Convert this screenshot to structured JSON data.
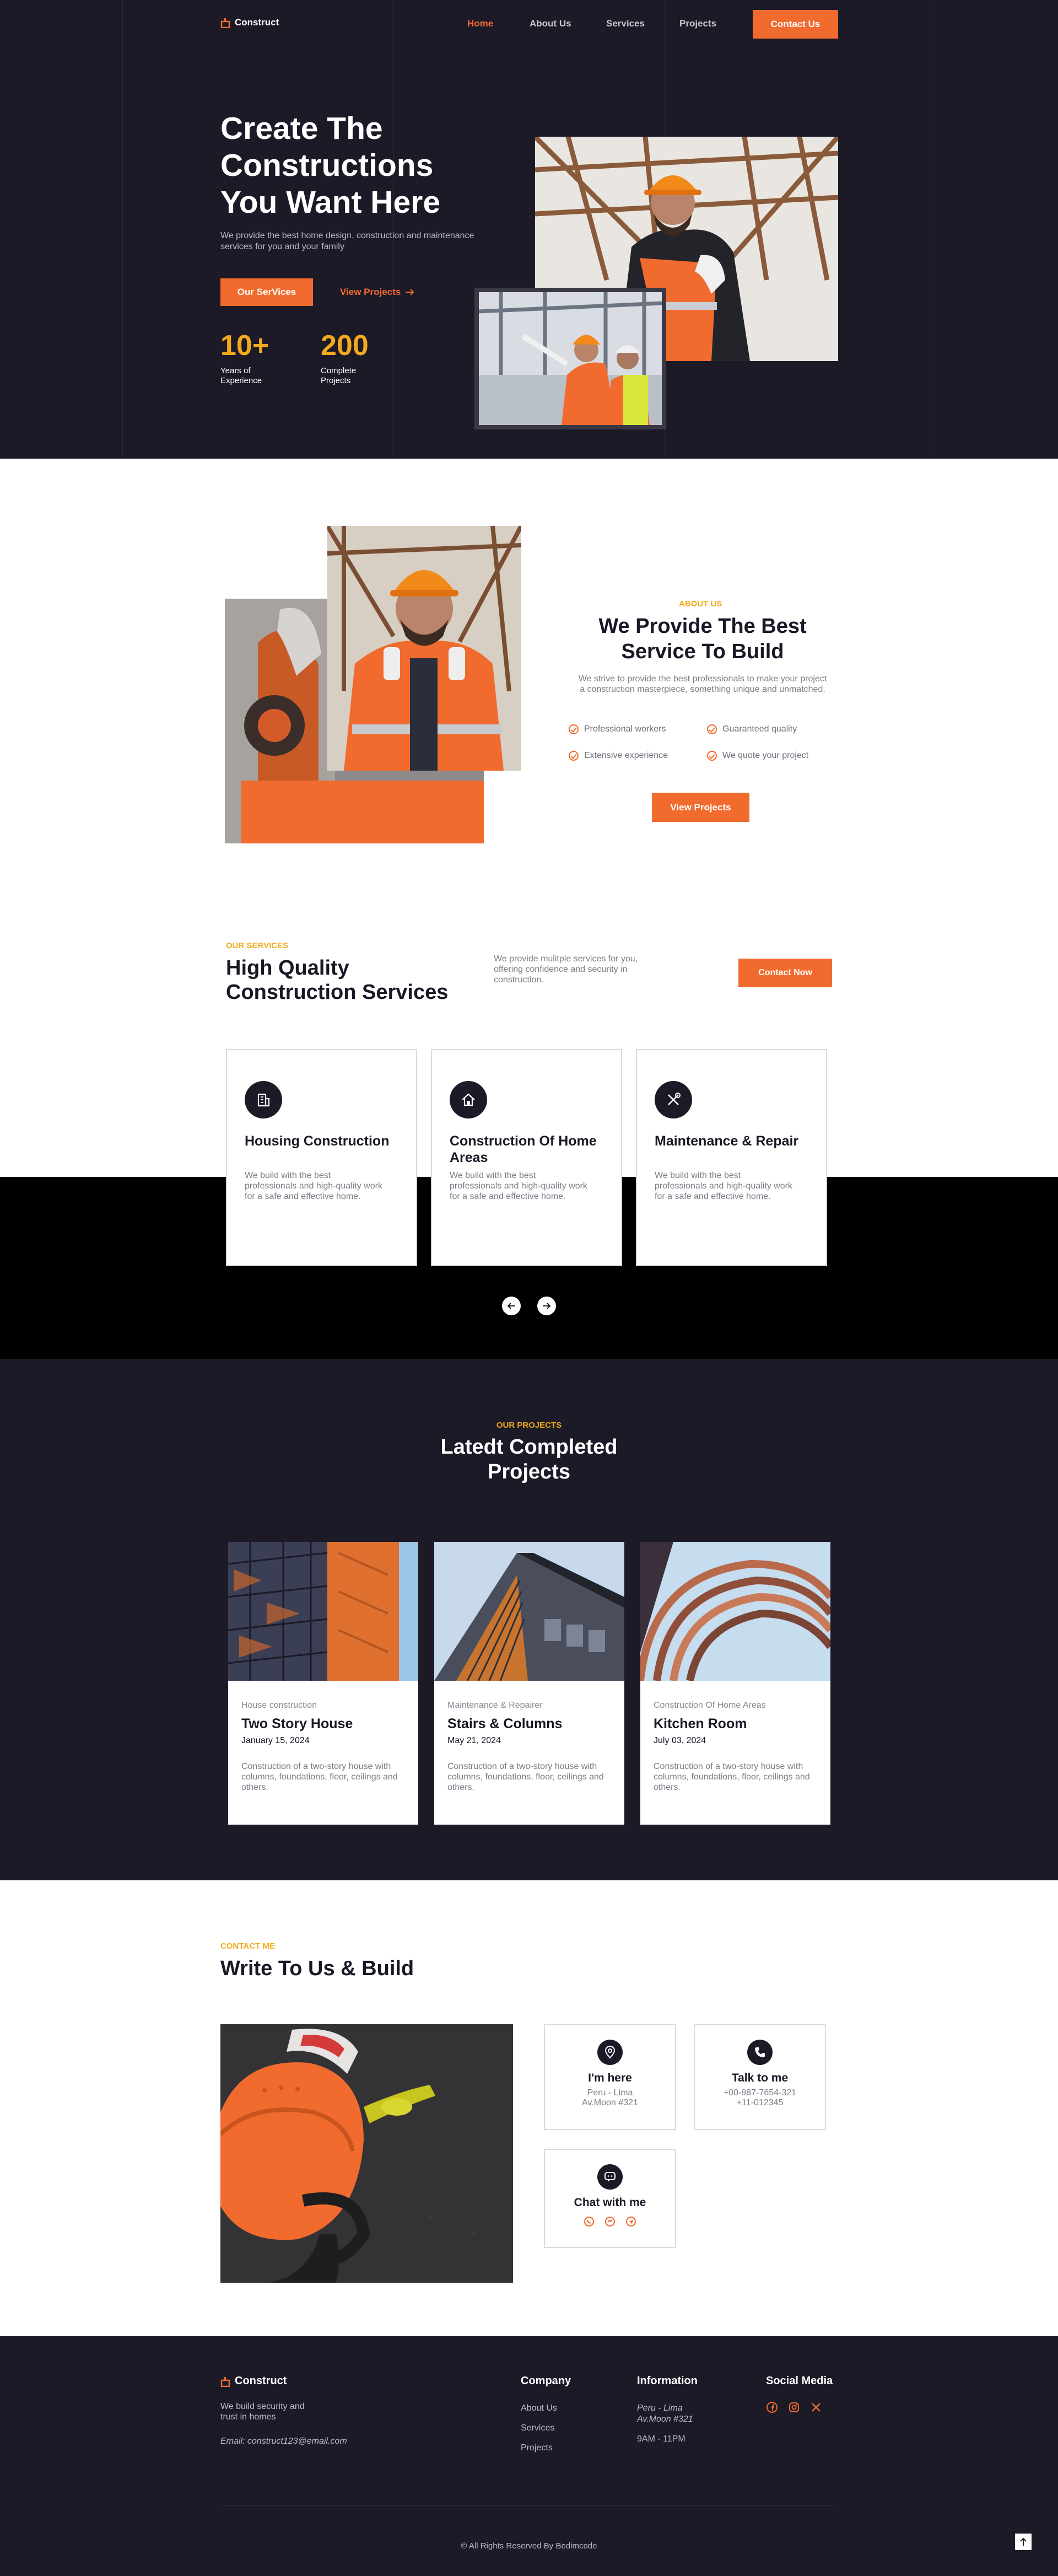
{
  "nav": {
    "brand": "Construct",
    "links": [
      "Home",
      "About Us",
      "Services",
      "Projects"
    ],
    "contact_label": "Contact Us"
  },
  "hero": {
    "title": "Create The Constructions You Want Here",
    "subtitle": "We provide the best home design, construction and maintenance services for you and your family",
    "primary_button": "Our SerVices",
    "secondary_button": "View Projects",
    "stats": [
      {
        "value": "10+",
        "label_line1": "Years of",
        "label_line2": "Experience"
      },
      {
        "value": "200",
        "label_line1": "Complete",
        "label_line2": "Projects"
      }
    ]
  },
  "about": {
    "eyebrow": "ABOUT US",
    "title": "We Provide The Best Service To Build",
    "text": "We strive to provide the best professionals to make your project a construction masterpiece, something unique and unmatched.",
    "checks": [
      "Professional workers",
      "Guaranteed quality",
      "Extensive experience",
      "We quote your project"
    ],
    "button": "View Projects"
  },
  "services": {
    "eyebrow": "OUR SERVICES",
    "title": "High Quality Construction Services",
    "text": "We provide mulitple services for you, offering confidence and security in construction.",
    "button": "Contact Now",
    "cards": [
      {
        "name": "Housing Construction",
        "desc": "We build with the best professionals and high-quality work for a safe and effective home.",
        "icon": "building-icon"
      },
      {
        "name": "Construction Of Home Areas",
        "desc": "We build with the best professionals and high-quality work for a safe and effective home.",
        "icon": "home-icon"
      },
      {
        "name": "Maintenance & Repair",
        "desc": "We build with the best professionals and high-quality work for a safe and effective home.",
        "icon": "tools-icon"
      }
    ]
  },
  "projects": {
    "eyebrow": "OUR PROJECTS",
    "title": "Latedt Completed Projects",
    "items": [
      {
        "category": "House construction",
        "name": "Two Story House",
        "date": "January 15, 2024",
        "desc": "Construction of a two-story house with columns, foundations, floor, ceilings and others."
      },
      {
        "category": "Maintenance & Repairer",
        "name": "Stairs & Columns",
        "date": "May 21, 2024",
        "desc": "Construction of a two-story house with columns, foundations, floor, ceilings and others."
      },
      {
        "category": "Construction Of Home Areas",
        "name": "Kitchen Room",
        "date": "July 03, 2024",
        "desc": "Construction of a two-story house with columns, foundations, floor, ceilings and others."
      }
    ]
  },
  "contact": {
    "eyebrow": "CONTACT ME",
    "title": "Write To Us & Build",
    "here": {
      "title": "I'm here",
      "line1": "Peru - Lima",
      "line2": "Av.Moon #321"
    },
    "talk": {
      "title": "Talk to me",
      "line1": "+00-987-7654-321",
      "line2": "+11-012345"
    },
    "chat": {
      "title": "Chat with me"
    }
  },
  "footer": {
    "brand": "Construct",
    "tagline": "We build security and trust in homes",
    "email": "Email: construct123@email.com",
    "company": {
      "heading": "Company",
      "links": [
        "About Us",
        "Services",
        "Projects"
      ]
    },
    "information": {
      "heading": "Information",
      "address1": "Peru - Lima",
      "address2": "Av.Moon #321",
      "hours": "9AM - 11PM"
    },
    "social": {
      "heading": "Social Media"
    },
    "copyright": "© All Rights Reserved By Bedimcode"
  },
  "colors": {
    "accent": "#f26b2e",
    "eyebrow": "#f2a91d",
    "dark": "#1c1a27"
  }
}
